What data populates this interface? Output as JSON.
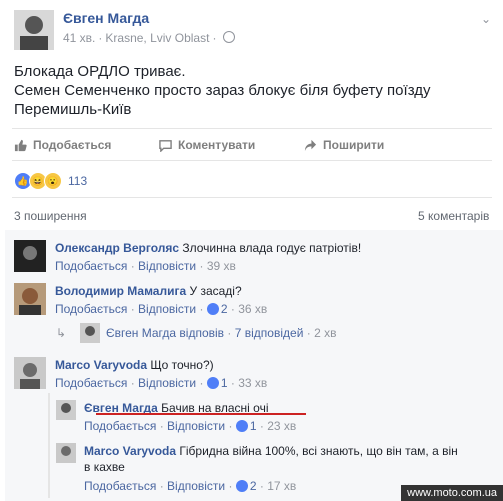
{
  "post": {
    "author": "Євген Магда",
    "time": "41 хв.",
    "location": "Krasne, Lviv Oblast",
    "text_lines": [
      "Блокада ОРДЛО триває.",
      "Семен Семенченко просто зараз блокує біля буфету поїзду",
      "Перемишль-Київ"
    ]
  },
  "actions": {
    "like": "Подобається",
    "comment": "Коментувати",
    "share": "Поширити"
  },
  "reactions": {
    "count": "113"
  },
  "stats": {
    "shares": "3 поширення",
    "comments": "5 коментарів"
  },
  "comments": [
    {
      "name": "Олександр Верголяс",
      "text": "Злочинна влада годує патріотів!",
      "like": "Подобається",
      "reply": "Відповісти",
      "likes": "",
      "time": "39 хв"
    },
    {
      "name": "Володимир Мамалига",
      "text": "У засаді?",
      "like": "Подобається",
      "reply": "Відповісти",
      "likes": "2",
      "time": "36 хв"
    },
    {
      "name": "Marco Varyvoda",
      "text": "Що точно?)",
      "like": "Подобається",
      "reply": "Відповісти",
      "likes": "1",
      "time": "33 хв"
    }
  ],
  "reply_summary": {
    "author": "Євген Магда",
    "verb": "відповів",
    "replies": "7 відповідей",
    "time": "2 хв"
  },
  "replies": [
    {
      "name": "Євген Магда",
      "text": "Бачив на власні очі",
      "like": "Подобається",
      "reply": "Відповісти",
      "likes": "1",
      "time": "23 хв"
    },
    {
      "name": "Marco Varyvoda",
      "text_line1": "Гібридна війна 100%, всі знають, що він там, а він",
      "text_line2": "в кахве",
      "like": "Подобається",
      "reply": "Відповісти",
      "likes": "2",
      "time": "17 хв"
    }
  ],
  "watermark": "www.moto.com.ua",
  "colors": {
    "link": "#365899",
    "muted": "#90949c",
    "like_blue": "#4f7ef7",
    "underline": "#cc2222"
  }
}
